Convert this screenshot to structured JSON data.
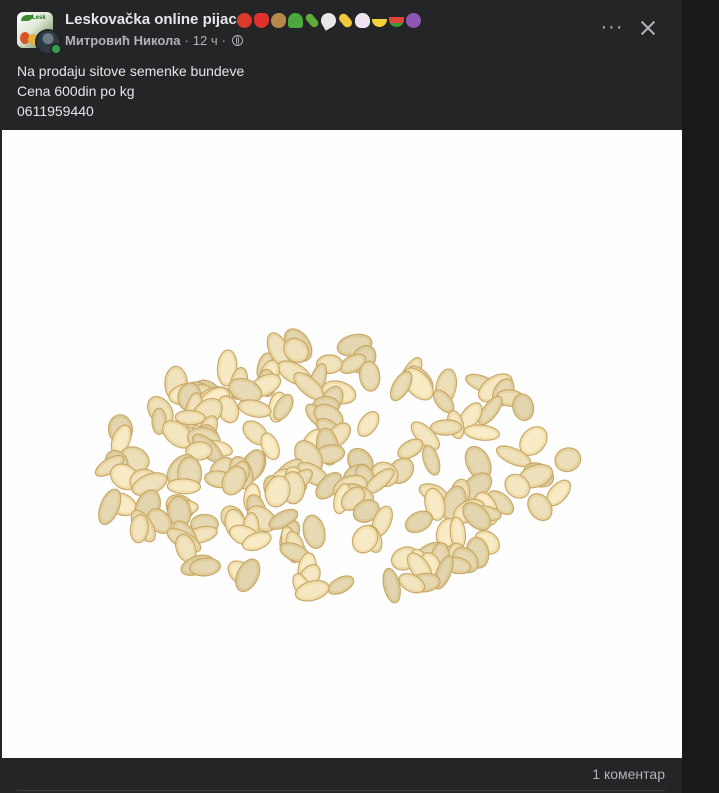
{
  "post": {
    "group_name": "Leskovačka online pijaca",
    "group_emojis": [
      "apple-emoji",
      "strawberry-emoji",
      "potato-emoji",
      "broccoli-emoji",
      "cucumber-emoji",
      "radish-emoji",
      "corn-emoji",
      "garlic-emoji",
      "banana-emoji",
      "watermelon-emoji",
      "grapes-emoji"
    ],
    "author": "Митровић Никола",
    "time": "12 ч",
    "separator": "·",
    "audience_icon": "globe-icon",
    "text_lines": [
      "Na prodaju sitove semenke bundeve",
      "Cena 600din po kg",
      "0611959440"
    ],
    "photo_subject": "pumpkin-seeds-photo"
  },
  "actions": {
    "more_icon": "more-horizontal-icon",
    "close_icon": "close-icon"
  },
  "footer": {
    "comment_count": "1 коментар"
  },
  "colors": {
    "card_bg": "#242526",
    "page_bg": "#18191a",
    "primary_text": "#e4e6eb",
    "secondary_text": "#b0b3b8"
  }
}
